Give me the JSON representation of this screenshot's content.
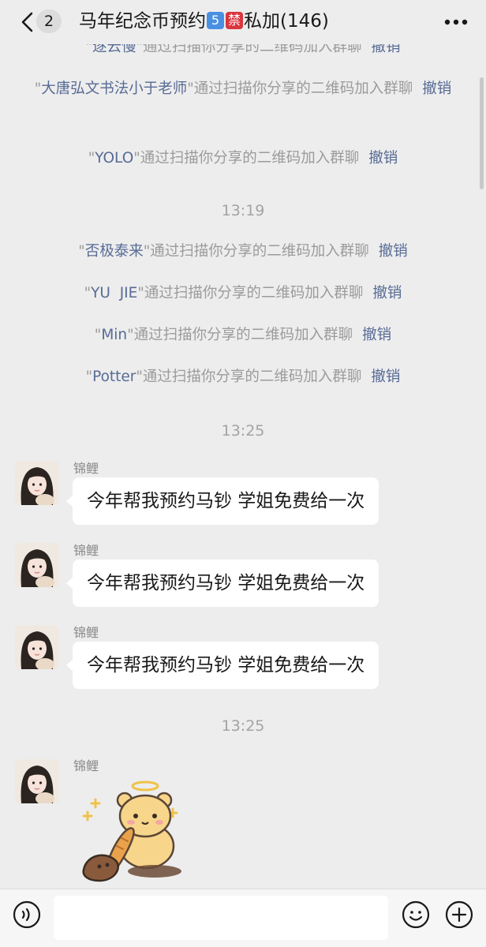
{
  "header": {
    "unread_count": "2",
    "title_prefix": "马年纪念币预约",
    "badge_num": "5",
    "badge_ban": "禁",
    "title_suffix": "私加(146)"
  },
  "system_rows": [
    {
      "name": "逐云慢",
      "text": "通过扫描你分享的二维码加入群聊",
      "action": "撤销"
    },
    {
      "name": "大唐弘文书法小于老师",
      "text": "通过扫描你分享的二维码加入群聊",
      "action": "撤销"
    },
    {
      "name": "YOLO",
      "text": "通过扫描你分享的二维码加入群聊",
      "action": "撤销"
    },
    {
      "name": "否极泰来",
      "text": "通过扫描你分享的二维码加入群聊",
      "action": "撤销"
    },
    {
      "name": "YU  JIE",
      "text": "通过扫描你分享的二维码加入群聊",
      "action": "撤销"
    },
    {
      "name": "Min",
      "text": "通过扫描你分享的二维码加入群聊",
      "action": "撤销"
    },
    {
      "name": "Potter",
      "text": "通过扫描你分享的二维码加入群聊",
      "action": "撤销"
    }
  ],
  "timestamps": [
    "13:19",
    "13:25",
    "13:25"
  ],
  "messages": [
    {
      "sender": "锦鲤",
      "text": "今年帮我预约马钞 学姐免费给一次"
    },
    {
      "sender": "锦鲤",
      "text": "今年帮我预约马钞 学姐免费给一次"
    },
    {
      "sender": "锦鲤",
      "text": "今年帮我预约马钞 学姐免费给一次"
    },
    {
      "sender": "锦鲤",
      "sticker": "bear-angel-bread-sticker"
    }
  ],
  "icons": {
    "back": "chevron-left-icon",
    "more": "more-dots-icon",
    "voice": "voice-icon",
    "emoji": "emoji-icon",
    "plus": "plus-icon"
  },
  "colors": {
    "background": "#ededed",
    "link": "#576b95",
    "badge_num": "#4a90e2",
    "badge_ban": "#d9363e"
  }
}
